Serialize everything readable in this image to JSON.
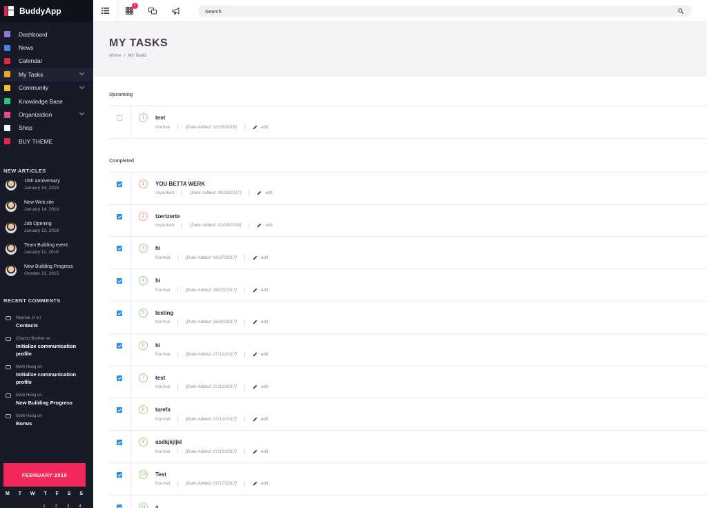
{
  "brand": {
    "name": "BuddyApp"
  },
  "nav": [
    {
      "label": "Dashboard",
      "icon": "dashboard-icon",
      "color": "#8e7bd6",
      "chevron": false
    },
    {
      "label": "News",
      "icon": "news-icon",
      "color": "#4a7fe0",
      "chevron": false
    },
    {
      "label": "Calendar",
      "icon": "calendar-icon",
      "color": "#e8254b",
      "chevron": false
    },
    {
      "label": "My Tasks",
      "icon": "tasks-icon",
      "color": "#f0a52a",
      "chevron": true
    },
    {
      "label": "Community",
      "icon": "community-icon",
      "color": "#f0c12a",
      "chevron": true
    },
    {
      "label": "Knowledge Base",
      "icon": "knowledge-icon",
      "color": "#33c27a",
      "chevron": false
    },
    {
      "label": "Organization",
      "icon": "organization-icon",
      "color": "#e84b8a",
      "chevron": true
    },
    {
      "label": "Shop",
      "icon": "shop-icon",
      "color": "#ffffff",
      "chevron": false
    },
    {
      "label": "BUY THEME",
      "icon": "cart-icon",
      "color": "#e8254b",
      "chevron": false
    }
  ],
  "new_articles": {
    "heading": "NEW ARTICLES",
    "items": [
      {
        "title": "15th anniversary",
        "date": "January 14, 2016"
      },
      {
        "title": "New Web site",
        "date": "January 14, 2016"
      },
      {
        "title": "Job Opening",
        "date": "January 12, 2016"
      },
      {
        "title": "Team Building event",
        "date": "January 11, 2016"
      },
      {
        "title": "New Building Progress",
        "date": "October 21, 2015"
      }
    ]
  },
  "recent_comments": {
    "heading": "RECENT COMMENTS",
    "on": "on",
    "items": [
      {
        "author": "Neymar Jr",
        "title": "Contacts"
      },
      {
        "author": "Chacho Brother",
        "title": "Initialize communication profile"
      },
      {
        "author": "Mark Hoog",
        "title": "Initialize communication profile"
      },
      {
        "author": "Mark Hoog",
        "title": "New Building Progress"
      },
      {
        "author": "Mark Hoog",
        "title": "Bonus"
      }
    ]
  },
  "calendar": {
    "month": "FEBRUARY 2018",
    "days": [
      "M",
      "T",
      "W",
      "T",
      "F",
      "S",
      "S"
    ],
    "first_row": [
      "",
      "",
      "",
      "1",
      "2",
      "3",
      "4"
    ]
  },
  "topbar": {
    "badge": "1",
    "search_placeholder": "Search"
  },
  "page": {
    "title": "MY TASKS",
    "breadcrumb": [
      "Home",
      "My Tasks"
    ],
    "breadcrumb_sep": "/"
  },
  "sections": {
    "upcoming": "Upcoming",
    "completed": "Completed"
  },
  "edit_label": "edit",
  "upcoming_tasks": [
    {
      "num": "1",
      "title": "test",
      "priority": "Normal",
      "date": "[Date Added: 02/05/2018]",
      "done": false
    }
  ],
  "completed_tasks": [
    {
      "num": "1",
      "title": "YOU BETTA WERK",
      "priority": "Important",
      "date": "[Date Added: 06/28/2017]",
      "done": true
    },
    {
      "num": "2",
      "title": "tzertzerte",
      "priority": "Important",
      "date": "[Date Added: 02/05/2018]",
      "done": true
    },
    {
      "num": "3",
      "title": "hi",
      "priority": "Normal",
      "date": "[Date Added: 06/27/2017]",
      "done": true
    },
    {
      "num": "4",
      "title": "hi",
      "priority": "Normal",
      "date": "[Date Added: 06/27/2017]",
      "done": true
    },
    {
      "num": "5",
      "title": "testing",
      "priority": "Normal",
      "date": "[Date Added: 06/30/2017]",
      "done": true
    },
    {
      "num": "6",
      "title": "hi",
      "priority": "Normal",
      "date": "[Date Added: 07/12/2017]",
      "done": true
    },
    {
      "num": "7",
      "title": "test",
      "priority": "Normal",
      "date": "[Date Added: 07/12/2017]",
      "done": true
    },
    {
      "num": "8",
      "title": "tarefa",
      "priority": "Normal",
      "date": "[Date Added: 07/13/2017]",
      "done": true
    },
    {
      "num": "9",
      "title": "asdkjkjljkl",
      "priority": "Normal",
      "date": "[Date Added: 07/15/2017]",
      "done": true
    },
    {
      "num": "10",
      "title": "Test",
      "priority": "Normal",
      "date": "[Date Added: 07/17/2017]",
      "done": true
    },
    {
      "num": "11",
      "title": "a",
      "priority": "Normal",
      "date": "[Date Added: 07/17/2017]",
      "done": true
    }
  ]
}
